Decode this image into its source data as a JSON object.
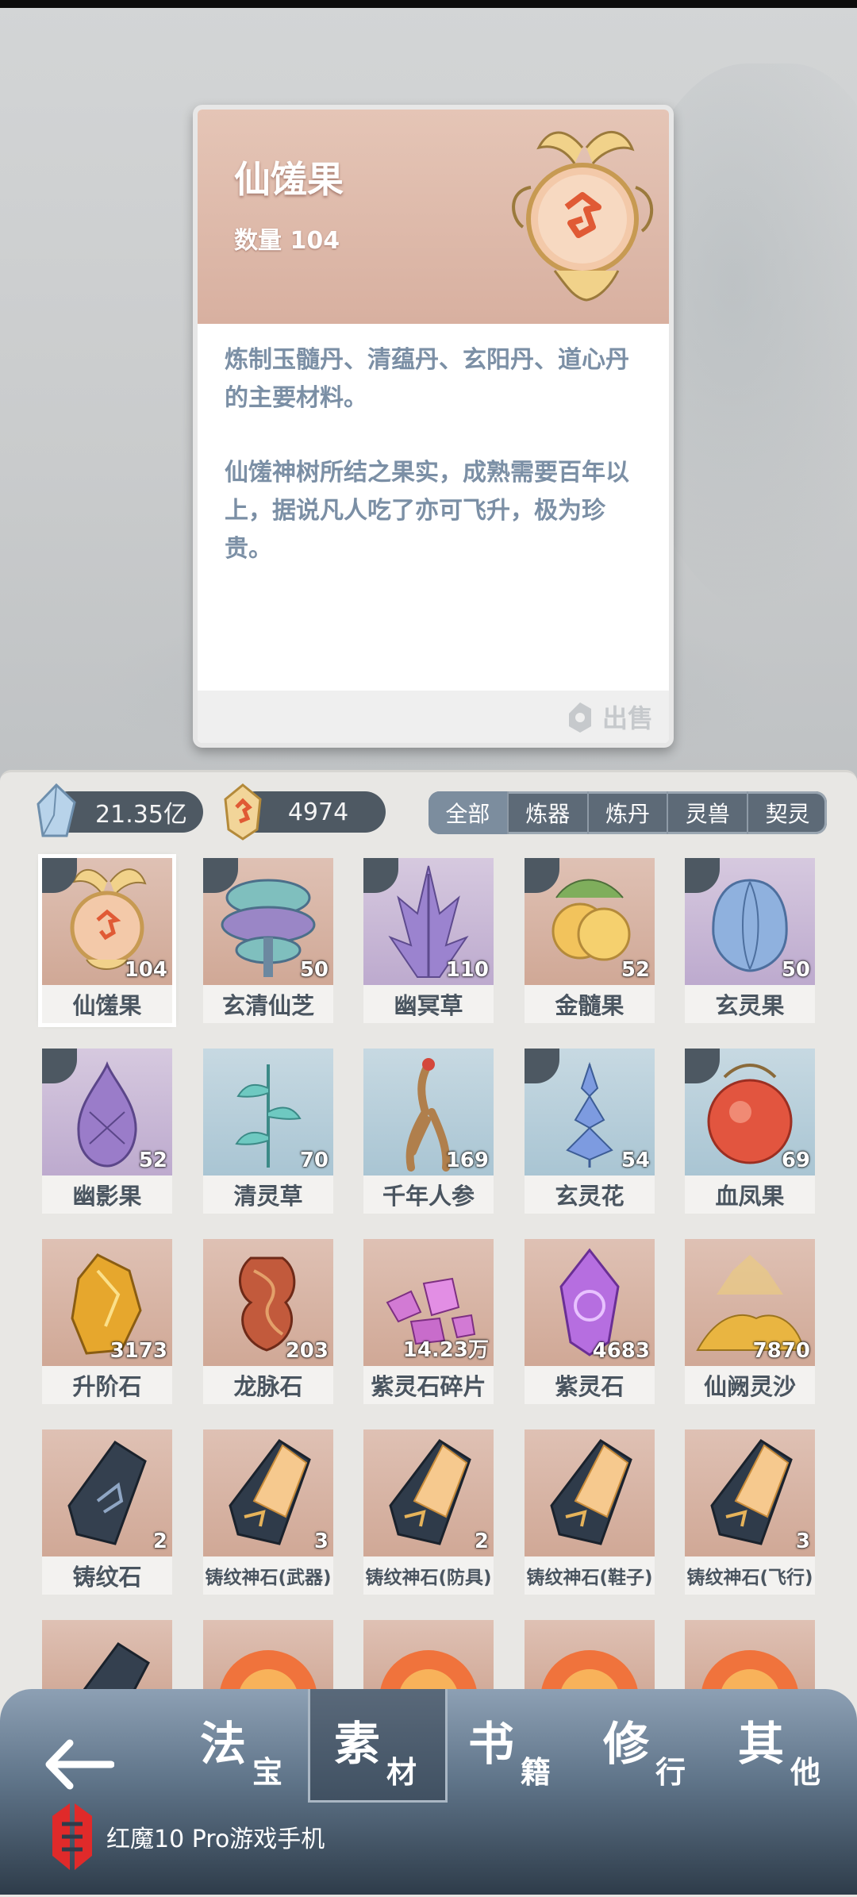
{
  "detail": {
    "title": "仙馐果",
    "count_label": "数量 104",
    "desc_1": "炼制玉髓丹、清蕴丹、玄阳丹、道心丹的主要材料。",
    "desc_2": "仙馐神树所结之果实，成熟需要百年以上，据说凡人吃了亦可飞升，极为珍贵。",
    "sell_label": "出售",
    "colors": {
      "header": "#dcb8a8",
      "text": "#7b8fa5"
    }
  },
  "currencies": {
    "spirit_stone": "21.35亿",
    "token": "4974"
  },
  "filters": [
    "全部",
    "炼器",
    "炼丹",
    "灵兽",
    "契灵"
  ],
  "items": [
    {
      "name": "仙馐果",
      "count": "104",
      "icon": "golden-fruit-icon"
    },
    {
      "name": "玄清仙芝",
      "count": "50",
      "icon": "mushroom-icon"
    },
    {
      "name": "幽冥草",
      "count": "110",
      "icon": "purple-herb-icon"
    },
    {
      "name": "金髓果",
      "count": "52",
      "icon": "golden-peach-icon"
    },
    {
      "name": "玄灵果",
      "count": "50",
      "icon": "blue-fruit-icon"
    },
    {
      "name": "幽影果",
      "count": "52",
      "icon": "purple-fruit-icon"
    },
    {
      "name": "清灵草",
      "count": "70",
      "icon": "teal-herb-icon"
    },
    {
      "name": "千年人参",
      "count": "169",
      "icon": "ginseng-icon"
    },
    {
      "name": "玄灵花",
      "count": "54",
      "icon": "blue-flower-icon"
    },
    {
      "name": "血凤果",
      "count": "69",
      "icon": "red-fruit-icon"
    },
    {
      "name": "升阶石",
      "count": "3173",
      "icon": "gold-ore-icon"
    },
    {
      "name": "龙脉石",
      "count": "203",
      "icon": "dragon-stone-icon"
    },
    {
      "name": "紫灵石碎片",
      "count": "14.23万",
      "icon": "purple-shards-icon"
    },
    {
      "name": "紫灵石",
      "count": "4683",
      "icon": "purple-crystal-icon"
    },
    {
      "name": "仙阙灵沙",
      "count": "7870",
      "icon": "golden-sand-icon"
    },
    {
      "name": "铸纹石",
      "count": "2",
      "icon": "rune-stone-icon"
    },
    {
      "name": "铸纹神石(武器)",
      "count": "3",
      "icon": "divine-rune-stone-icon"
    },
    {
      "name": "铸纹神石(防具)",
      "count": "2",
      "icon": "divine-rune-stone-icon"
    },
    {
      "name": "铸纹神石(鞋子)",
      "count": "",
      "icon": "divine-rune-stone-icon"
    },
    {
      "name": "铸纹神石(飞行)",
      "count": "3",
      "icon": "divine-rune-stone-icon"
    }
  ],
  "nav": {
    "tabs": [
      {
        "big": "法",
        "small": "宝"
      },
      {
        "big": "素",
        "small": "材"
      },
      {
        "big": "书",
        "small": "籍"
      },
      {
        "big": "修",
        "small": "行"
      },
      {
        "big": "其",
        "small": "他"
      }
    ],
    "active": "素材",
    "brand": "红魔10 Pro游戏手机"
  }
}
